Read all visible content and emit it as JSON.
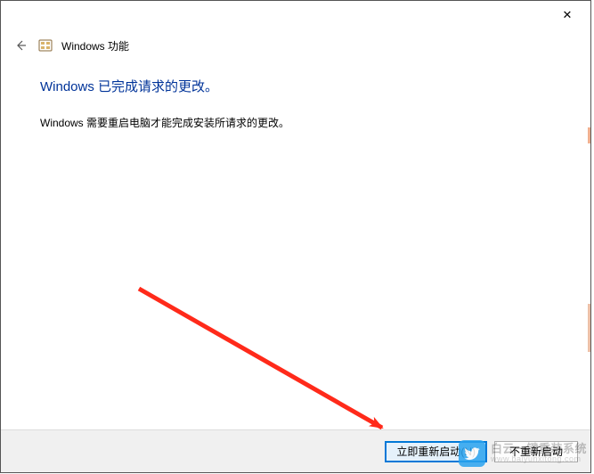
{
  "window": {
    "close_glyph": "✕"
  },
  "header": {
    "back_glyph": "←",
    "title": "Windows 功能"
  },
  "content": {
    "heading": "Windows 已完成请求的更改。",
    "body": "Windows 需要重启电脑才能完成安装所请求的更改。"
  },
  "footer": {
    "restart_now": "立即重新启动(N)",
    "dont_restart": "不重新启动"
  },
  "watermark": {
    "line1": "白云一键重装系统",
    "line2": "www.baiyunxitong.com"
  },
  "colors": {
    "heading": "#003399",
    "accent": "#0078d7",
    "arrow": "#ff2a1a"
  }
}
